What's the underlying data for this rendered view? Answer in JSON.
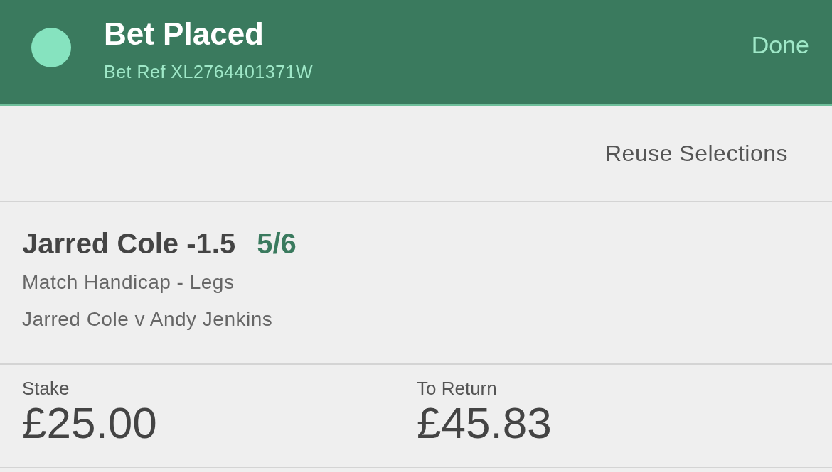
{
  "header": {
    "title": "Bet Placed",
    "bet_ref": "Bet Ref XL2764401371W",
    "done_button": "Done"
  },
  "reuse_link": "Reuse Selections",
  "selection": {
    "name": "Jarred Cole -1.5",
    "odds": "5/6",
    "market": "Match Handicap - Legs",
    "event": "Jarred Cole v Andy Jenkins"
  },
  "totals": [
    {
      "label": "Stake",
      "value": "£25.00"
    },
    {
      "label": "To Return",
      "value": "£45.83"
    }
  ]
}
